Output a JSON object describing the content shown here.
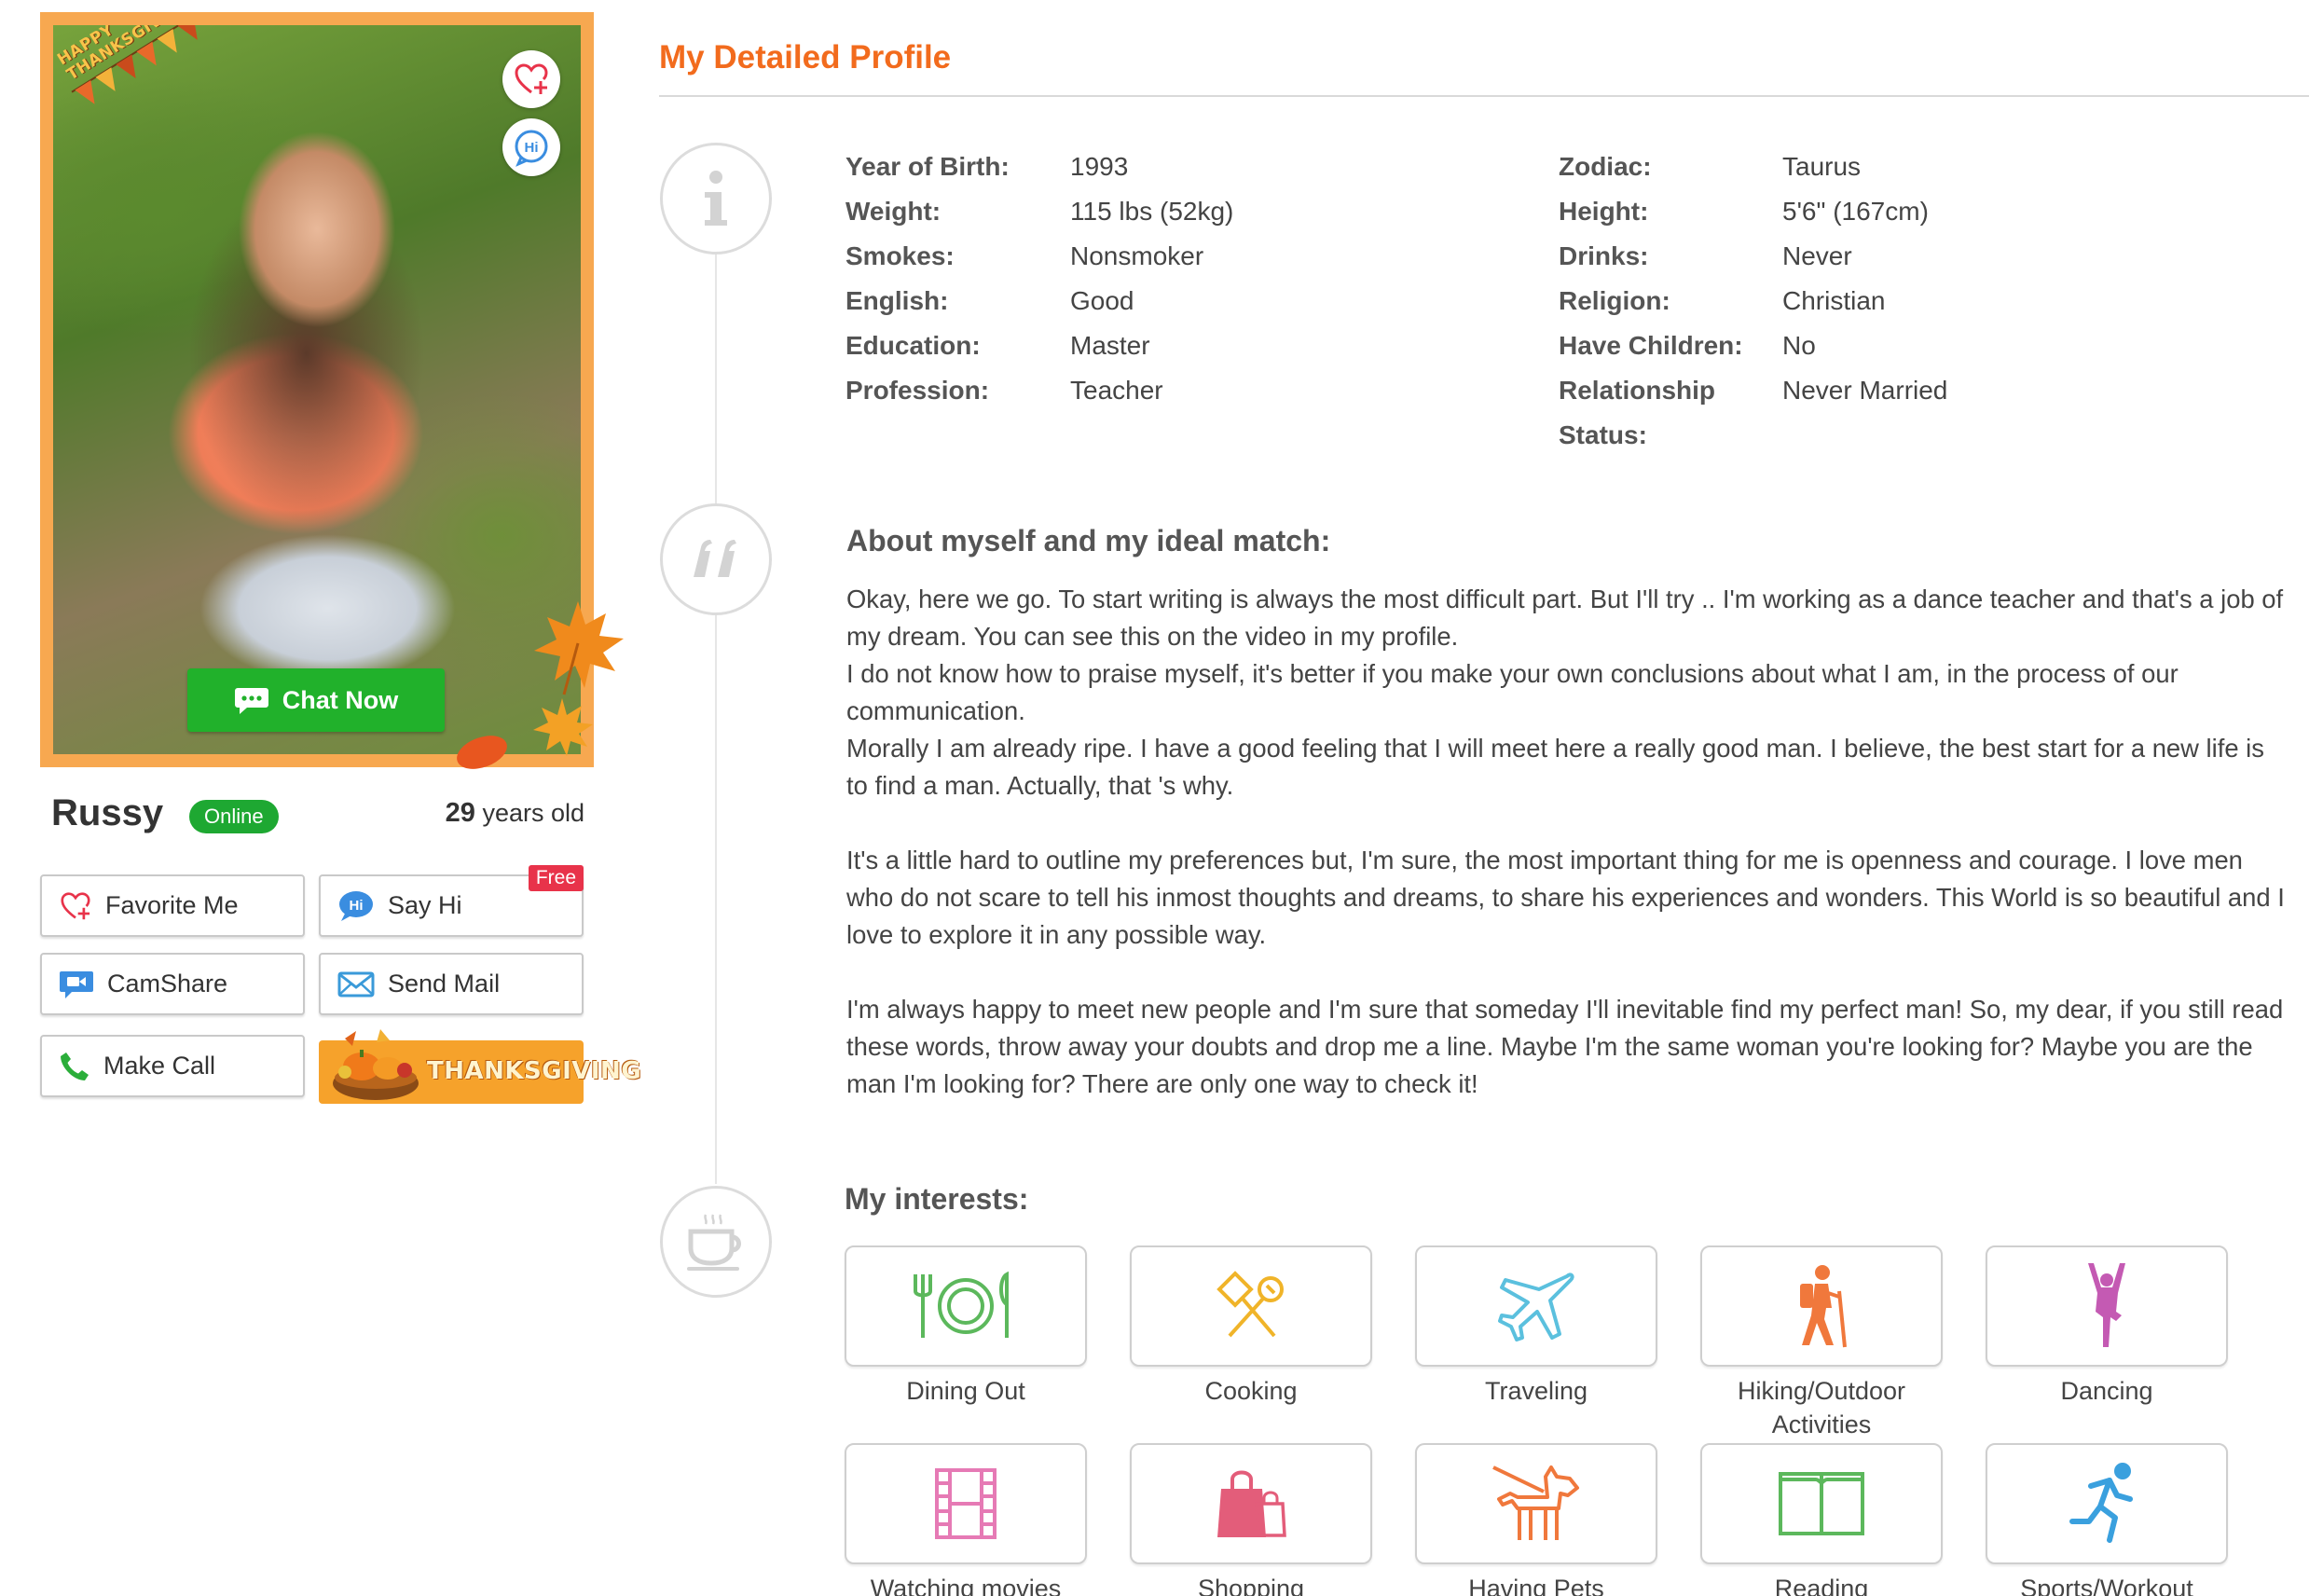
{
  "profile": {
    "name": "Russy",
    "status": "Online",
    "age_number": "29",
    "age_suffix": "years old",
    "photo_banner": "HAPPY THANKSGIVING",
    "chat_now": "Chat Now"
  },
  "actions": {
    "favorite": "Favorite Me",
    "say_hi": "Say Hi",
    "free": "Free",
    "camshare": "CamShare",
    "send_mail": "Send Mail",
    "make_call": "Make Call",
    "thanksgiving": "THANKSGIVING"
  },
  "details": {
    "title": "My Detailed Profile",
    "left": [
      {
        "label": "Year of Birth:",
        "value": "1993"
      },
      {
        "label": "Weight:",
        "value": "115 lbs (52kg)"
      },
      {
        "label": "Smokes:",
        "value": "Nonsmoker"
      },
      {
        "label": "English:",
        "value": "Good"
      },
      {
        "label": "Education:",
        "value": "Master"
      },
      {
        "label": "Profession:",
        "value": "Teacher"
      }
    ],
    "right": [
      {
        "label": "Zodiac:",
        "value": "Taurus"
      },
      {
        "label": "Height:",
        "value": "5'6\" (167cm)"
      },
      {
        "label": "Drinks:",
        "value": "Never"
      },
      {
        "label": "Religion:",
        "value": "Christian"
      },
      {
        "label": "Have Children:",
        "value": "No"
      },
      {
        "label": "Relationship",
        "label2": "Status:",
        "value": "Never Married"
      }
    ]
  },
  "about": {
    "title": "About myself and my ideal match:",
    "p1a": "Okay, here we go. To start writing is always the most difficult part. But I'll try .. I'm working as a dance teacher and that's a job of my dream. You can see this on the video in my profile.",
    "p1b": "I do not know how to praise myself, it's better if you make your own conclusions about what I am, in the process of our communication.",
    "p1c": "Morally I am already ripe. I have a good feeling that I will meet here a really good man. I believe, the best start for a new life is to find a man. Actually, that 's why.",
    "p2": "It's a little hard to outline my preferences but, I'm sure, the most important thing for me is openness and courage. I love men who do not scare to tell his inmost thoughts and dreams, to share his experiences and wonders. This World is so beautiful and I love to explore it in any possible way.",
    "p3": "I'm always happy to meet new people and I'm sure that someday I'll inevitable find my perfect man! So, my dear, if you still read these words, throw away your doubts and drop me a line. Maybe I'm the same woman you're looking for? Maybe you are the man I'm looking for? There are only one way to check it!"
  },
  "interests": {
    "title": "My interests:",
    "items": [
      {
        "label": "Dining Out",
        "icon": "dining-icon",
        "color": "#5cb85c"
      },
      {
        "label": "Cooking",
        "icon": "cooking-icon",
        "color": "#f0b429"
      },
      {
        "label": "Traveling",
        "icon": "airplane-icon",
        "color": "#5bc0de"
      },
      {
        "label": "Hiking/Outdoor Activities",
        "icon": "hiking-icon",
        "color": "#f0783c"
      },
      {
        "label": "Dancing",
        "icon": "dancing-icon",
        "color": "#c45ab3"
      },
      {
        "label": "Watching movies",
        "icon": "film-icon",
        "color": "#e67ab5"
      },
      {
        "label": "Shopping",
        "icon": "shopping-bag-icon",
        "color": "#e35d7a"
      },
      {
        "label": "Having Pets",
        "icon": "dog-icon",
        "color": "#f0783c"
      },
      {
        "label": "Reading",
        "icon": "book-icon",
        "color": "#5cb85c"
      },
      {
        "label": "Sports/Workout",
        "icon": "running-icon",
        "color": "#3aa0de"
      }
    ]
  },
  "colors": {
    "accent": "#f26b1d",
    "online": "#1ea832",
    "chat": "#21b12b",
    "photo_frame": "#f7a850"
  }
}
